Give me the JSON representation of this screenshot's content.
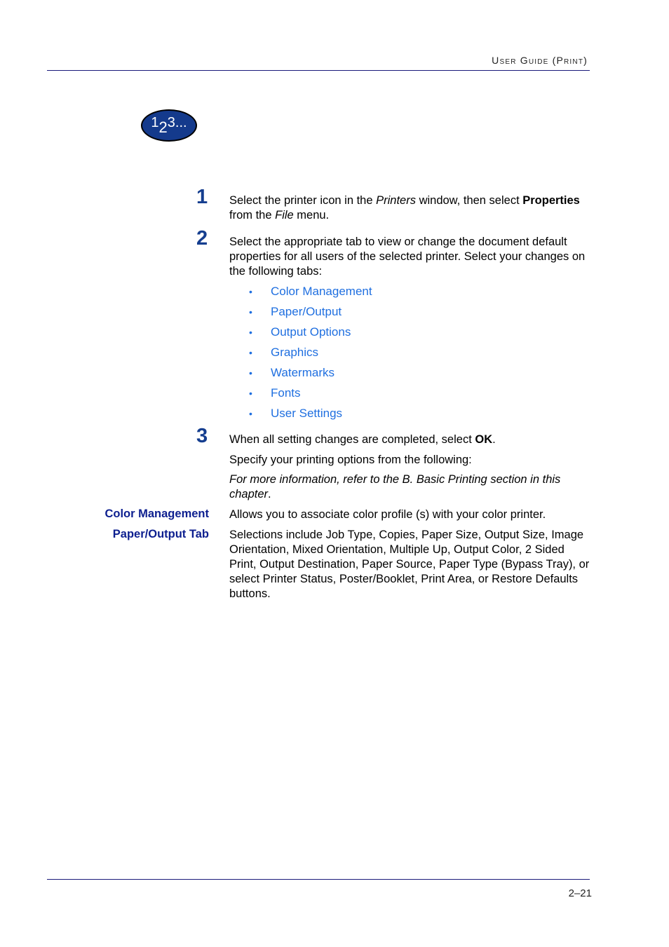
{
  "header": {
    "title": "User Guide (Print)"
  },
  "badge": {
    "icon": "steps-123-icon",
    "d1": "1",
    "d2": "2",
    "d3": "3..."
  },
  "steps": [
    {
      "number": "1",
      "parts": [
        "Select the printer icon in the ",
        "Printers",
        " window, then select ",
        "Properties",
        " from the ",
        "File",
        " menu."
      ]
    },
    {
      "number": "2",
      "text": "Select the appropriate tab to view or change the document default properties for all users of the selected printer. Select your changes on the following tabs:",
      "links": [
        "Color Management",
        "Paper/Output",
        "Output Options",
        "Graphics",
        "Watermarks",
        "Fonts",
        "User Settings"
      ],
      "bullet": "•"
    },
    {
      "number": "3",
      "parts": [
        "When all setting changes are completed, select ",
        "OK",
        "."
      ],
      "followup": "Specify your printing options from the following:",
      "note_italic": "For more information, refer to the B. Basic Printing section in this chapter",
      "note_end": "."
    }
  ],
  "definitions": [
    {
      "term": "Color Management",
      "description": "Allows you to associate color profile (s) with your color printer."
    },
    {
      "term": "Paper/Output Tab",
      "description": "Selections include Job Type, Copies, Paper Size, Output Size, Image Orientation, Mixed Orientation, Multiple Up, Output Color, 2 Sided Print, Output Destination, Paper Source, Paper Type (Bypass Tray), or select Printer Status, Poster/Booklet, Print Area, or Restore Defaults buttons."
    }
  ],
  "footer": {
    "page_number": "2–21"
  },
  "colors": {
    "link": "#1f6fe0",
    "step_number": "#153e8f",
    "term": "#0d1f8f",
    "rule": "#1a1a7a",
    "badge": "#143a8c"
  }
}
